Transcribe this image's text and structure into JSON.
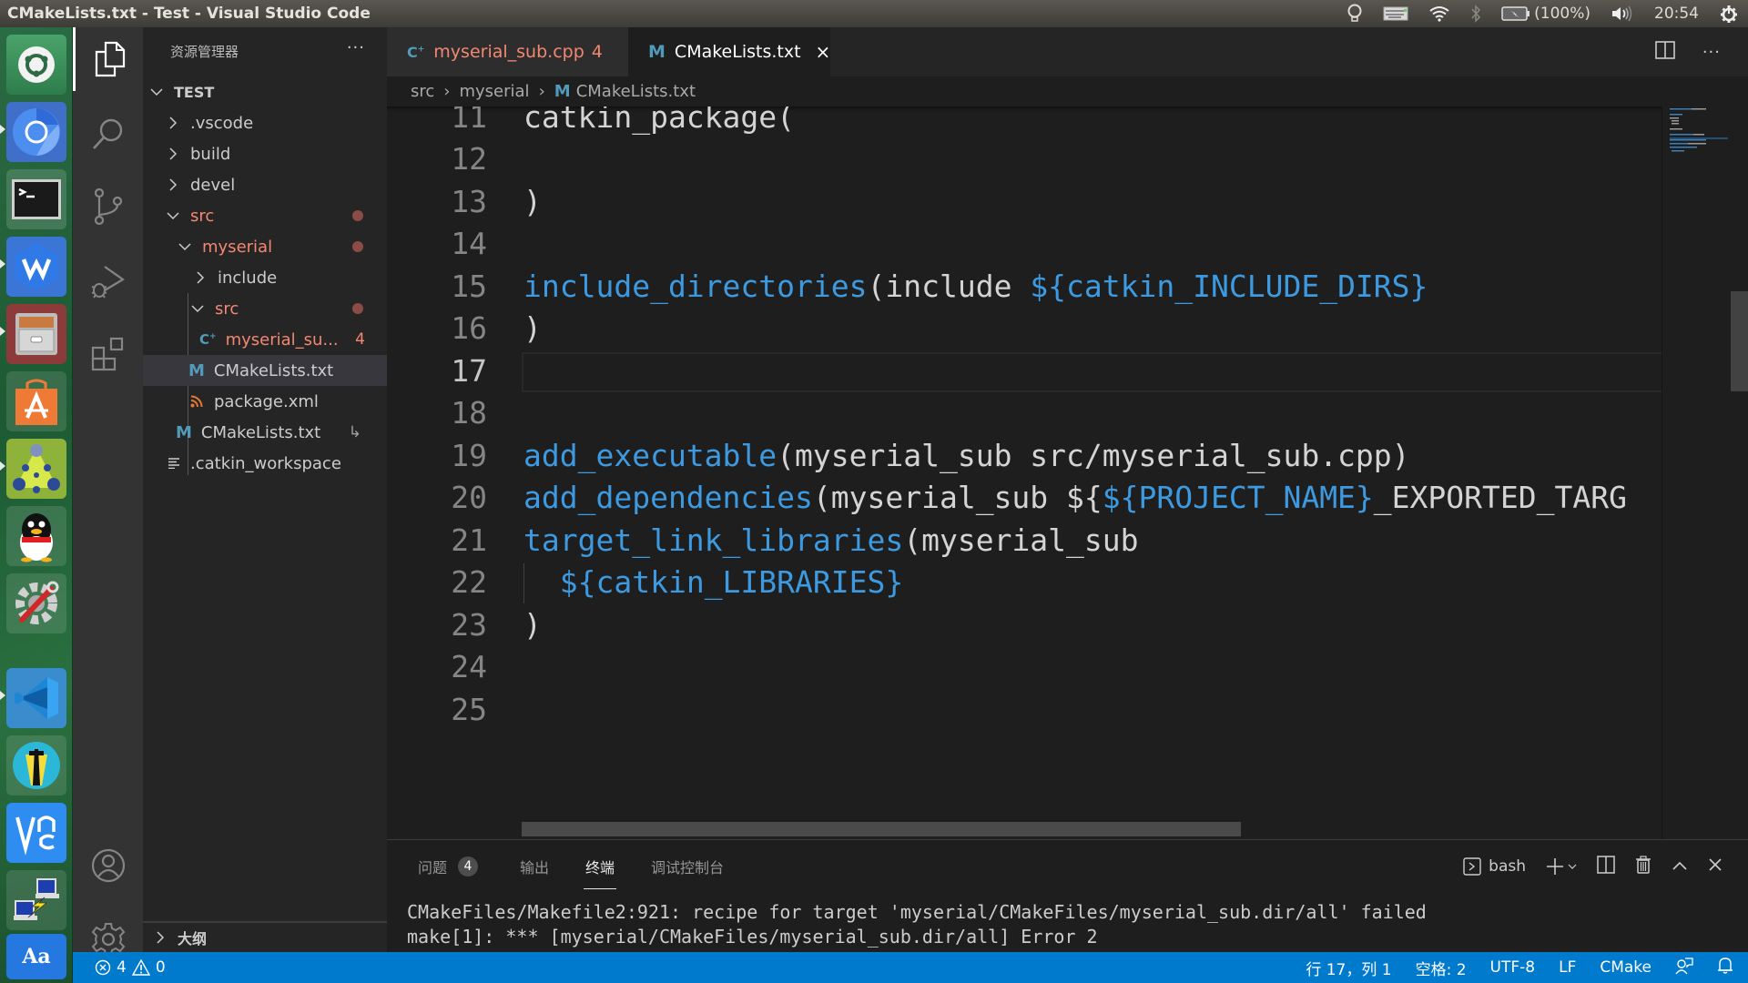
{
  "window": {
    "title": "CMakeLists.txt - Test - Visual Studio Code"
  },
  "system_tray": {
    "battery": "(100%)",
    "time": "20:54",
    "icons": [
      "indicator-lightbulb-icon",
      "keyboard-icon",
      "wifi-icon",
      "bluetooth-icon",
      "battery-icon",
      "volume-icon",
      "power-gear-icon"
    ]
  },
  "dock": {
    "apps": [
      {
        "name": "ubuntu-dash",
        "running": false
      },
      {
        "name": "chromium",
        "running": true
      },
      {
        "name": "terminal",
        "running": false
      },
      {
        "name": "wps-office",
        "running": true
      },
      {
        "name": "file-cabinet",
        "running": true
      },
      {
        "name": "software-center",
        "running": false
      },
      {
        "name": "network-app",
        "running": true
      },
      {
        "name": "qq",
        "running": false
      },
      {
        "name": "system-settings",
        "running": false
      },
      {
        "name": "visual-studio-code",
        "running": true
      },
      {
        "name": "lighthouse-app",
        "running": false
      },
      {
        "name": "vnc-viewer",
        "running": false
      },
      {
        "name": "remote-desktop",
        "running": false
      },
      {
        "name": "dictionary",
        "running": false
      }
    ]
  },
  "activity_bar": {
    "items": [
      "explorer-icon",
      "search-icon",
      "source-control-icon",
      "run-debug-icon",
      "extensions-icon"
    ],
    "bottom": [
      "account-icon",
      "settings-gear-icon"
    ]
  },
  "sidebar": {
    "title": "资源管理器",
    "more": "···",
    "root": "TEST",
    "tree": [
      {
        "label": ".vscode",
        "type": "folder",
        "expanded": false,
        "depth": 1
      },
      {
        "label": "build",
        "type": "folder",
        "expanded": false,
        "depth": 1
      },
      {
        "label": "devel",
        "type": "folder",
        "expanded": false,
        "depth": 1
      },
      {
        "label": "src",
        "type": "folder",
        "expanded": true,
        "depth": 1,
        "error": true
      },
      {
        "label": "myserial",
        "type": "folder",
        "expanded": true,
        "depth": 2,
        "error": true
      },
      {
        "label": "include",
        "type": "folder",
        "expanded": false,
        "depth": 3
      },
      {
        "label": "src",
        "type": "folder",
        "expanded": true,
        "depth": 3,
        "error": true
      },
      {
        "label": "myserial_su...",
        "type": "cpp",
        "depth": 4,
        "error": true,
        "count": "4"
      },
      {
        "label": "CMakeLists.txt",
        "type": "cmake",
        "depth": 3,
        "selected": true
      },
      {
        "label": "package.xml",
        "type": "xml",
        "depth": 3
      },
      {
        "label": "CMakeLists.txt",
        "type": "cmake",
        "depth": 2,
        "symlink": "↳"
      },
      {
        "label": ".catkin_workspace",
        "type": "text",
        "depth": 1
      }
    ],
    "outline_label": "大纲"
  },
  "tabs": [
    {
      "label": "myserial_sub.cpp",
      "badge": "4",
      "active": false,
      "icon": "cpp-icon"
    },
    {
      "label": "CMakeLists.txt",
      "active": true,
      "icon": "cmake-icon",
      "close": "×"
    }
  ],
  "breadcrumb": [
    "src",
    "myserial",
    "CMakeLists.txt"
  ],
  "editor": {
    "current_line": 17,
    "lines": [
      {
        "n": "11",
        "tokens": [
          {
            "t": "catkin_package(",
            "c": "plain"
          }
        ]
      },
      {
        "n": "12",
        "tokens": []
      },
      {
        "n": "13",
        "tokens": [
          {
            "t": ")",
            "c": "plain"
          }
        ]
      },
      {
        "n": "14",
        "tokens": []
      },
      {
        "n": "15",
        "tokens": [
          {
            "t": "include_directories",
            "c": "fn"
          },
          {
            "t": "(include ",
            "c": "plain"
          },
          {
            "t": "${catkin_INCLUDE_DIRS}",
            "c": "var"
          }
        ]
      },
      {
        "n": "16",
        "tokens": [
          {
            "t": ")",
            "c": "plain"
          }
        ]
      },
      {
        "n": "17",
        "tokens": []
      },
      {
        "n": "18",
        "tokens": []
      },
      {
        "n": "19",
        "tokens": [
          {
            "t": "add_executable",
            "c": "fn"
          },
          {
            "t": "(myserial_sub src/myserial_sub.cpp)",
            "c": "plain"
          }
        ]
      },
      {
        "n": "20",
        "tokens": [
          {
            "t": "add_dependencies",
            "c": "fn"
          },
          {
            "t": "(myserial_sub ${",
            "c": "plain"
          },
          {
            "t": "${PROJECT_NAME}",
            "c": "var"
          },
          {
            "t": "_EXPORTED_TARG",
            "c": "plain"
          }
        ]
      },
      {
        "n": "21",
        "tokens": [
          {
            "t": "target_link_libraries",
            "c": "fn"
          },
          {
            "t": "(myserial_sub",
            "c": "plain"
          }
        ]
      },
      {
        "n": "22",
        "tokens": [
          {
            "t": "  ",
            "c": "plain"
          },
          {
            "t": "${catkin_LIBRARIES}",
            "c": "var"
          }
        ]
      },
      {
        "n": "23",
        "tokens": [
          {
            "t": ")",
            "c": "plain"
          }
        ]
      },
      {
        "n": "24",
        "tokens": []
      },
      {
        "n": "25",
        "tokens": []
      }
    ]
  },
  "panel": {
    "tabs": [
      {
        "label": "问题",
        "badge": "4",
        "active": false
      },
      {
        "label": "输出",
        "active": false
      },
      {
        "label": "终端",
        "active": true
      },
      {
        "label": "调试控制台",
        "active": false
      }
    ],
    "terminal_name": "bash",
    "terminal_lines": [
      "CMakeFiles/Makefile2:921: recipe for target 'myserial/CMakeFiles/myserial_sub.dir/all' failed",
      "make[1]: *** [myserial/CMakeFiles/myserial_sub.dir/all] Error 2"
    ]
  },
  "statusbar": {
    "errors": "4",
    "warnings": "0",
    "position": "行 17，列 1",
    "indent": "空格: 2",
    "encoding": "UTF-8",
    "eol": "LF",
    "language": "CMake"
  },
  "colors": {
    "accent": "#007acc",
    "error": "#f48771",
    "keyword": "#3d9ae0"
  }
}
